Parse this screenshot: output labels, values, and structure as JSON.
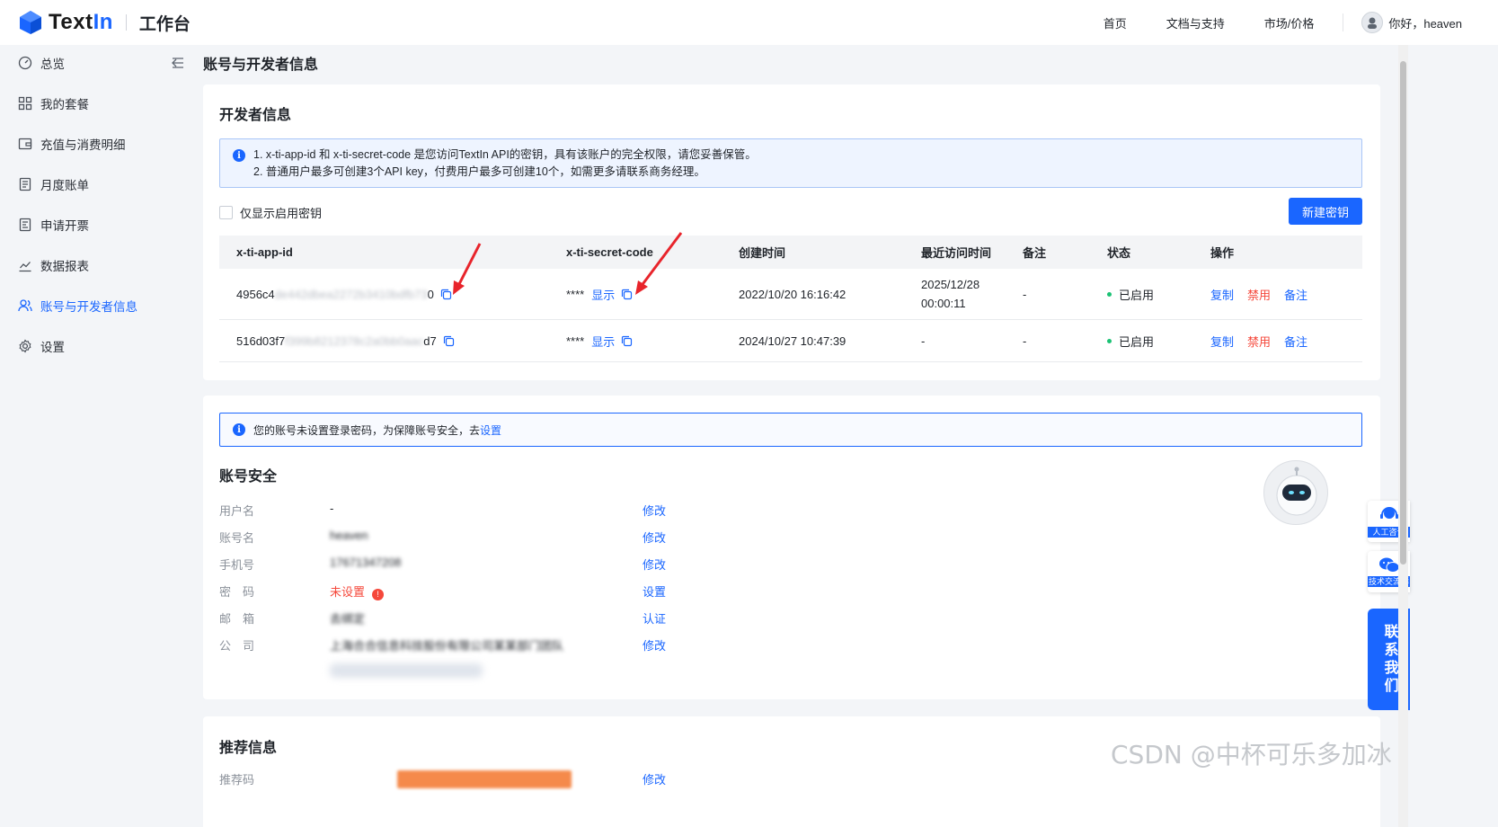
{
  "header": {
    "logo_text_a": "Text",
    "logo_text_b": "In",
    "workspace": "工作台",
    "nav": [
      "首页",
      "文档与支持",
      "市场/价格"
    ],
    "greeting": "你好，heaven"
  },
  "sidebar": {
    "items": [
      {
        "label": "总览",
        "icon": "dashboard-icon"
      },
      {
        "label": "我的套餐",
        "icon": "grid-icon"
      },
      {
        "label": "充值与消费明细",
        "icon": "wallet-icon"
      },
      {
        "label": "月度账单",
        "icon": "bill-icon"
      },
      {
        "label": "申请开票",
        "icon": "invoice-icon"
      },
      {
        "label": "数据报表",
        "icon": "chart-icon"
      },
      {
        "label": "账号与开发者信息",
        "icon": "users-icon",
        "active": true
      },
      {
        "label": "设置",
        "icon": "gear-icon"
      }
    ]
  },
  "page": {
    "title": "账号与开发者信息"
  },
  "developer": {
    "title": "开发者信息",
    "notice_line1": "1. x-ti-app-id 和 x-ti-secret-code 是您访问TextIn API的密钥，具有该账户的完全权限，请您妥善保管。",
    "notice_line2": "2. 普通用户最多可创建3个API key，付费用户最多可创建10个，如需更多请联系商务经理。",
    "filter_label": "仅显示启用密钥",
    "new_key_button": "新建密钥",
    "columns": [
      "x-ti-app-id",
      "x-ti-secret-code",
      "创建时间",
      "最近访问时间",
      "备注",
      "状态",
      "操作"
    ],
    "rows": [
      {
        "app_id_head": "4956c4",
        "app_id_mid": "de442dbea2272b3410bdfb73",
        "app_id_tail": "0",
        "secret_mask": "****",
        "show_label": "显示",
        "created": "2022/10/20 16:16:42",
        "last_access_line1": "2025/12/28",
        "last_access_line2": "00:00:11",
        "remark": "-",
        "status": "已启用",
        "actions": [
          "复制",
          "禁用",
          "备注"
        ]
      },
      {
        "app_id_head": "516d03f7",
        "app_id_mid": "f399b8212378c2a0bb0aac",
        "app_id_tail": "d7",
        "secret_mask": "****",
        "show_label": "显示",
        "created": "2024/10/27 10:47:39",
        "last_access_line1": "-",
        "last_access_line2": "",
        "remark": "-",
        "status": "已启用",
        "actions": [
          "复制",
          "禁用",
          "备注"
        ]
      }
    ]
  },
  "security": {
    "notice_text": "您的账号未设置登录密码，为保障账号安全，去",
    "notice_link": "设置",
    "title": "账号安全",
    "fields": [
      {
        "label": "用户名",
        "value": "-",
        "action": "修改"
      },
      {
        "label": "账号名",
        "value": "heaven",
        "action": "修改",
        "blurred": true
      },
      {
        "label": "手机号",
        "value": "17671347208",
        "action": "修改",
        "blurred": true
      },
      {
        "label": "密　码",
        "value": "未设置",
        "action": "设置",
        "warn": true
      },
      {
        "label": "邮　箱",
        "value": "去绑定",
        "action": "认证",
        "blurred": true
      },
      {
        "label": "公　司",
        "value": "上海合合信息科技股份有限公司某某部门团队",
        "action": "修改",
        "blurred": true
      }
    ]
  },
  "referral": {
    "title": "推荐信息",
    "row_label": "推荐码",
    "row_action": "修改"
  },
  "float": {
    "service": "人工咨询",
    "group": "技术交流群",
    "contact": "联系我们"
  },
  "watermark": "CSDN @中杯可乐多加冰"
}
